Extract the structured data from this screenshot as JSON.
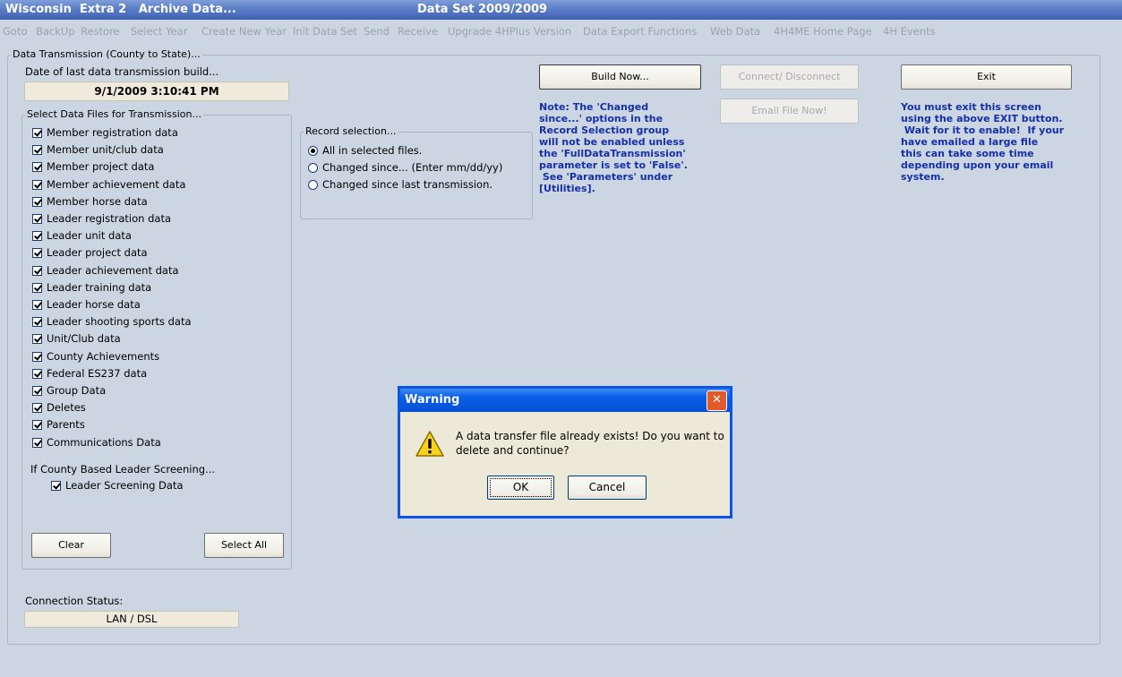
{
  "window": {
    "title_app": "Wisconsin  Extra 2   Archive Data...",
    "title_dataset": "Data Set 2009/2009"
  },
  "menu": [
    "Goto",
    "BackUp",
    "Restore",
    "Select Year",
    "Create New Year",
    "Init Data Set",
    "Send",
    "Receive",
    "Upgrade 4HPlus Version",
    "Data Export Functions",
    "Web Data",
    "4H4ME Home Page",
    "4H Events"
  ],
  "main_group_label": "Data Transmission (County to State)...",
  "last_build_label": "Date of last data transmission build...",
  "last_build_value": "9/1/2009 3:10:41 PM",
  "files_group_label": "Select Data Files for Transmission...",
  "files": [
    "Member registration data",
    "Member unit/club data",
    "Member project data",
    "Member achievement data",
    "Member horse data",
    "Leader registration data",
    "Leader unit data",
    "Leader project data",
    "Leader achievement data",
    "Leader training data",
    "Leader horse data",
    "Leader shooting sports data",
    "Unit/Club data",
    "County Achievements",
    "Federal ES237 data",
    "Group Data",
    "Deletes",
    "Parents",
    "Communications Data"
  ],
  "screening_label": "If County Based Leader Screening...",
  "screening_item": "Leader Screening Data",
  "clear_label": "Clear",
  "select_all_label": "Select All",
  "connection_label": "Connection Status:",
  "connection_value": "LAN / DSL",
  "record_group_label": "Record selection...",
  "record_options": [
    "All in selected files.",
    "Changed since... (Enter mm/dd/yy)",
    "Changed since last transmission."
  ],
  "build_now_label": "Build Now...",
  "connect_label": "Connect/ Disconnect",
  "email_label": "Email File Now!",
  "exit_label": "Exit",
  "note_lines": [
    "Note: The 'Changed",
    "since...' options in the",
    "Record Selection group",
    "will not be enabled unless",
    "the 'FullDataTransmission'",
    "parameter is set to 'False'.",
    " See 'Parameters' under",
    "[Utilities]."
  ],
  "exit_note_lines": [
    "You must exit this screen",
    "using the above EXIT button.",
    " Wait for it to enable!  If your",
    "have emailed a large file",
    "this can take some time",
    "depending upon your email",
    "system."
  ],
  "dialog": {
    "title": "Warning",
    "message_line1": "A data transfer file already exists! Do you want to",
    "message_line2": "delete and continue?",
    "ok_label": "OK",
    "cancel_label": "Cancel"
  }
}
